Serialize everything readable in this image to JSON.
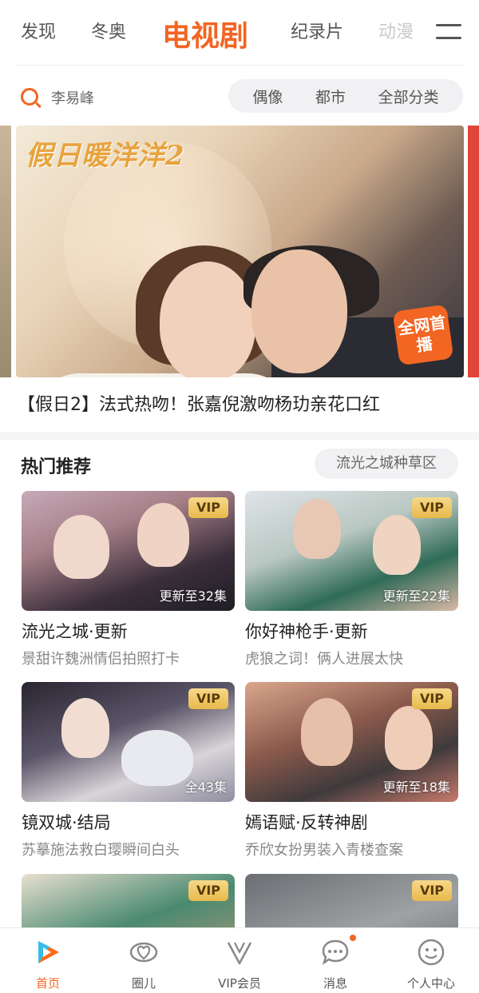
{
  "top_nav": {
    "tabs": [
      {
        "label": "发现"
      },
      {
        "label": "冬奥"
      },
      {
        "label": "电视剧"
      },
      {
        "label": "纪录片"
      },
      {
        "label": "动漫"
      }
    ],
    "active_tab": "电视剧",
    "accent_color": "#f26522"
  },
  "search": {
    "query": "李易峰",
    "quick_categories": [
      "偶像",
      "都市",
      "全部分类"
    ]
  },
  "banner": {
    "title_art": "假日暖洋洋2",
    "badge": "全网首播",
    "headline": "【假日2】法式热吻！张嘉倪激吻杨玏亲花口红"
  },
  "hot": {
    "title": "热门推荐",
    "link": "流光之城种草区",
    "cards": [
      {
        "title": "流光之城·更新",
        "subtitle": "景甜许魏洲情侣拍照打卡",
        "badge": "VIP",
        "episodes": "更新至32集"
      },
      {
        "title": "你好神枪手·更新",
        "subtitle": "虎狼之词！俩人进展太快",
        "badge": "VIP",
        "episodes": "更新至22集"
      },
      {
        "title": "镜双城·结局",
        "subtitle": "苏摹施法救白璎瞬间白头",
        "badge": "VIP",
        "episodes": "全43集"
      },
      {
        "title": "嫣语赋·反转神剧",
        "subtitle": "乔欣女扮男装入青楼查案",
        "badge": "VIP",
        "episodes": "更新至18集"
      },
      {
        "title": "",
        "subtitle": "",
        "badge": "VIP",
        "episodes": ""
      },
      {
        "title": "",
        "subtitle": "",
        "badge": "VIP",
        "episodes": ""
      }
    ]
  },
  "bottom_nav": {
    "items": [
      {
        "label": "首页",
        "icon": "home-play-icon"
      },
      {
        "label": "圈儿",
        "icon": "circle-heart-icon"
      },
      {
        "label": "VIP会员",
        "icon": "vip-v-icon"
      },
      {
        "label": "消息",
        "icon": "message-icon"
      },
      {
        "label": "个人中心",
        "icon": "profile-icon"
      }
    ],
    "active": "首页"
  }
}
